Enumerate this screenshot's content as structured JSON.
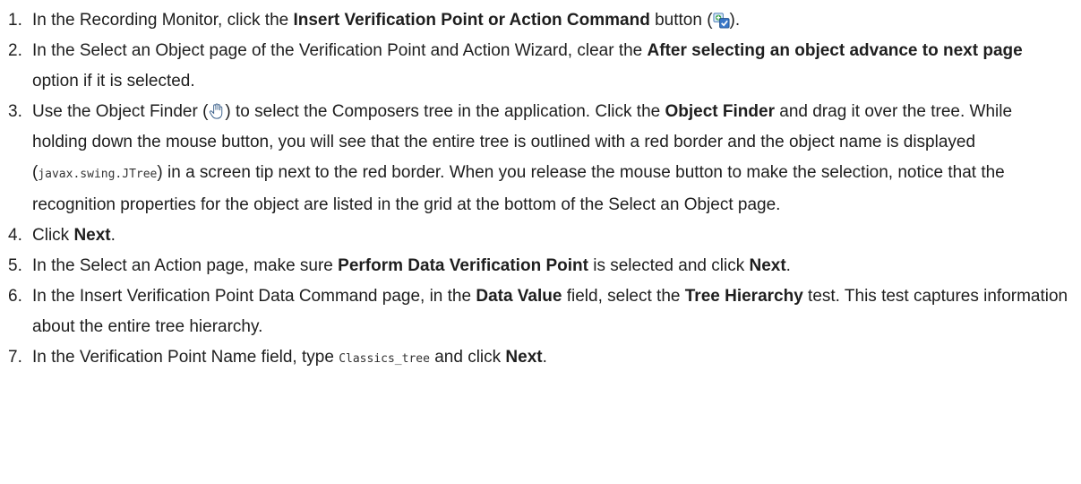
{
  "steps": [
    {
      "num": "1.",
      "parts": [
        {
          "t": "text",
          "v": "In the Recording Monitor, click the "
        },
        {
          "t": "bold",
          "v": "Insert Verification Point or Action Command"
        },
        {
          "t": "text",
          "v": " button ("
        },
        {
          "t": "icon",
          "v": "insert-verification-point-icon"
        },
        {
          "t": "text",
          "v": ")."
        }
      ]
    },
    {
      "num": "2.",
      "parts": [
        {
          "t": "text",
          "v": "In the Select an Object page of the Verification Point and Action Wizard, clear the "
        },
        {
          "t": "bold",
          "v": "After selecting an object advance to next page"
        },
        {
          "t": "text",
          "v": " option if it is selected."
        }
      ]
    },
    {
      "num": "3.",
      "parts": [
        {
          "t": "text",
          "v": "Use the Object Finder ("
        },
        {
          "t": "icon",
          "v": "object-finder-hand-icon"
        },
        {
          "t": "text",
          "v": ") to select the Composers tree in the application. Click the "
        },
        {
          "t": "bold",
          "v": "Object Finder"
        },
        {
          "t": "text",
          "v": " and drag it over the tree. While holding down the mouse button, you will see that the entire tree is outlined with a red border and the object name is displayed ("
        },
        {
          "t": "code",
          "v": "javax.swing.JTree"
        },
        {
          "t": "text",
          "v": ") in a screen tip next to the red border. When you release the mouse button to make the selection, notice that the recognition properties for the object are listed in the grid at the bottom of the Select an Object page."
        }
      ]
    },
    {
      "num": "4.",
      "parts": [
        {
          "t": "text",
          "v": "Click "
        },
        {
          "t": "bold",
          "v": "Next"
        },
        {
          "t": "text",
          "v": "."
        }
      ]
    },
    {
      "num": "5.",
      "parts": [
        {
          "t": "text",
          "v": "In the Select an Action page, make sure "
        },
        {
          "t": "bold",
          "v": "Perform Data Verification Point"
        },
        {
          "t": "text",
          "v": " is selected and click "
        },
        {
          "t": "bold",
          "v": "Next"
        },
        {
          "t": "text",
          "v": "."
        }
      ]
    },
    {
      "num": "6.",
      "parts": [
        {
          "t": "text",
          "v": "In the Insert Verification Point Data Command page, in the "
        },
        {
          "t": "bold",
          "v": "Data Value"
        },
        {
          "t": "text",
          "v": " field, select the "
        },
        {
          "t": "bold",
          "v": "Tree Hierarchy"
        },
        {
          "t": "text",
          "v": " test. This test captures information about the entire tree hierarchy."
        }
      ]
    },
    {
      "num": "7.",
      "parts": [
        {
          "t": "text",
          "v": "In the Verification Point Name field, type "
        },
        {
          "t": "code",
          "v": "Classics_tree"
        },
        {
          "t": "text",
          "v": " and click "
        },
        {
          "t": "bold",
          "v": "Next"
        },
        {
          "t": "text",
          "v": "."
        }
      ]
    }
  ]
}
